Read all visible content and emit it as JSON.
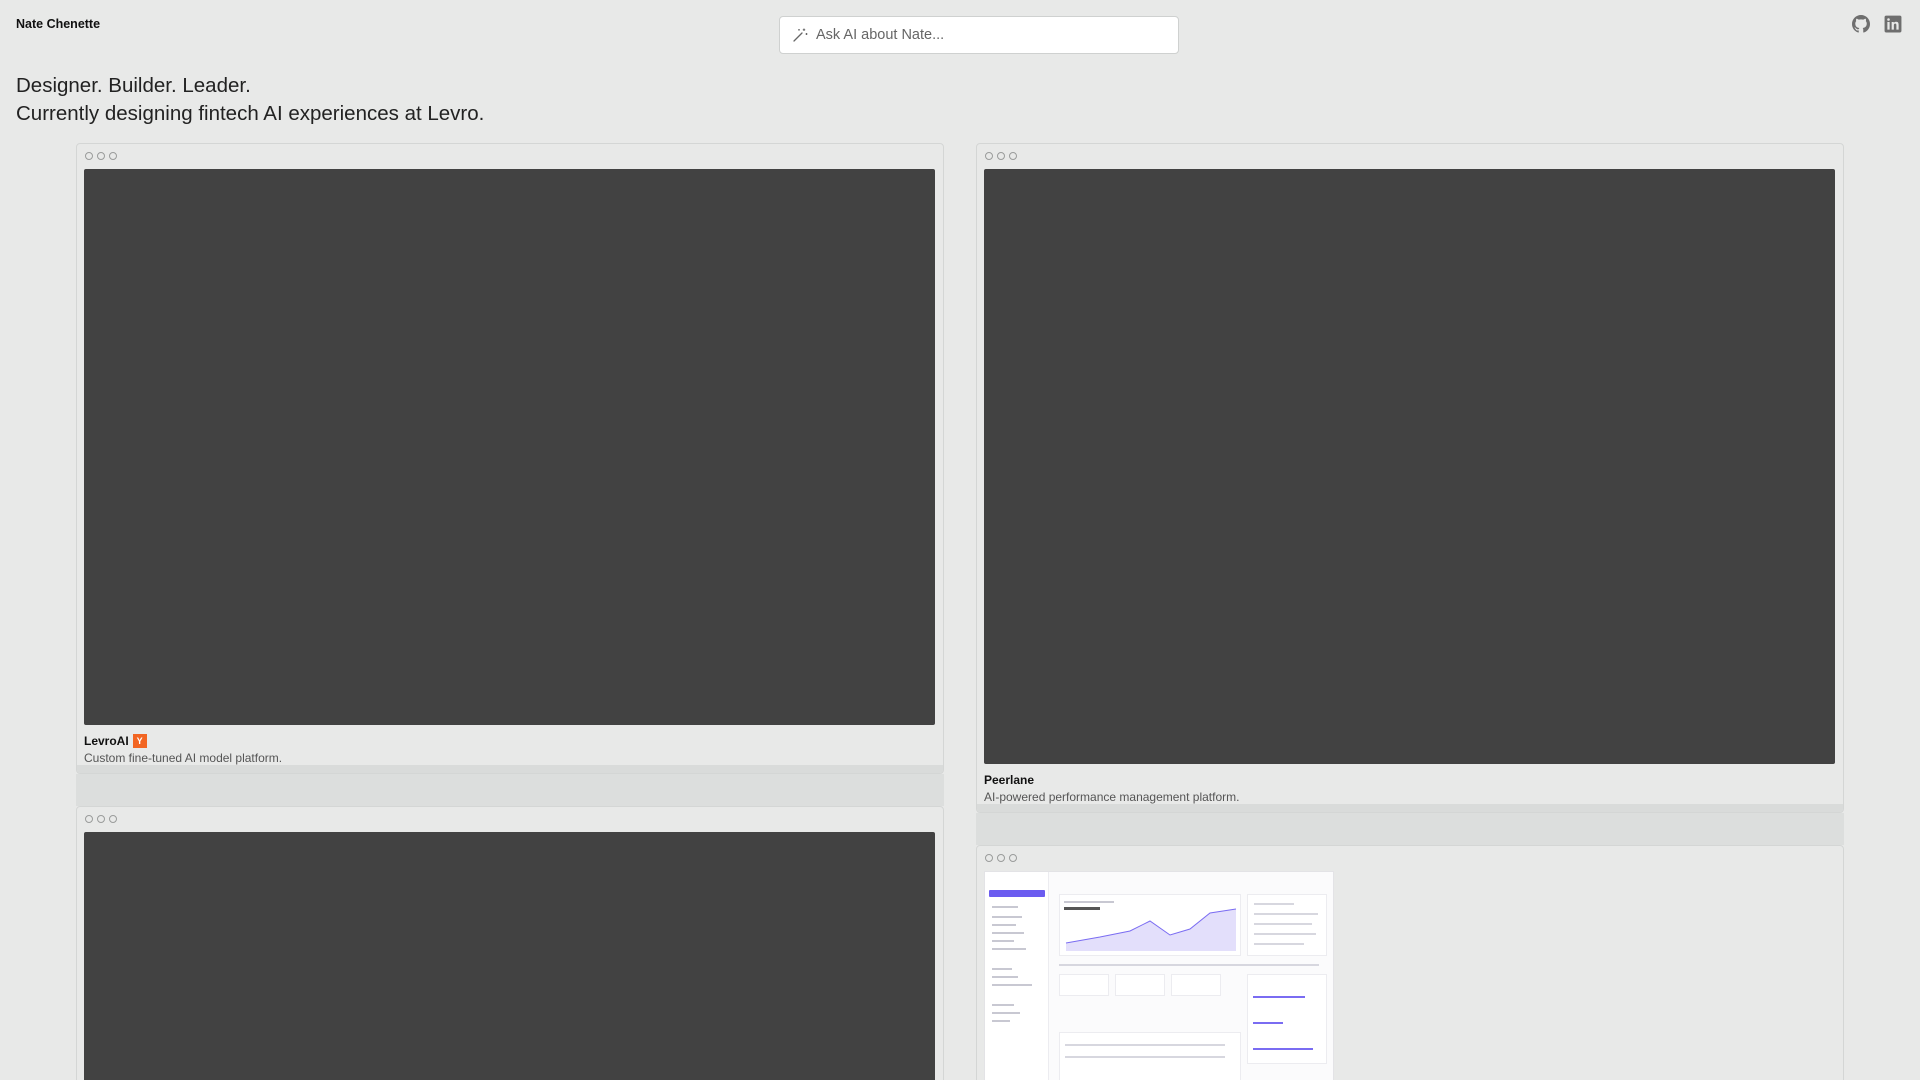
{
  "header": {
    "site_name": "Nate Chenette",
    "ask_placeholder": "Ask AI about Nate..."
  },
  "social": [
    {
      "icon": "github-icon"
    },
    {
      "icon": "linkedin-icon"
    }
  ],
  "hero": {
    "line1": "Designer. Builder. Leader.",
    "line2": "Currently designing fintech AI experiences at Levro."
  },
  "projects": [
    {
      "title": "LevroAI",
      "badge": "Y",
      "badge_color": "#f26522",
      "description": "Custom fine-tuned AI model platform."
    },
    {
      "title": "Peerlane",
      "description": "AI-powered performance management platform."
    },
    {
      "title": "",
      "description": ""
    },
    {
      "title": "",
      "description": ""
    }
  ],
  "colors": {
    "background": "#e8e9e8",
    "screen_placeholder": "#424242",
    "accent": "#6b5cf0"
  }
}
